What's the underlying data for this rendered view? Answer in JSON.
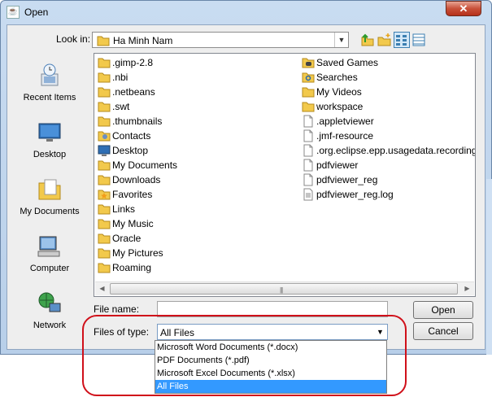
{
  "window": {
    "title": "Open",
    "icon": "java-cup-icon",
    "close_label": "✕"
  },
  "lookin": {
    "label": "Look in:",
    "value": "Ha Minh Nam"
  },
  "toolbar": [
    "up-folder-icon",
    "new-folder-icon",
    "list-view-icon",
    "details-view-icon"
  ],
  "places": [
    {
      "label": "Recent Items",
      "icon": "recent-items-icon"
    },
    {
      "label": "Desktop",
      "icon": "desktop-icon"
    },
    {
      "label": "My Documents",
      "icon": "my-documents-icon"
    },
    {
      "label": "Computer",
      "icon": "computer-icon"
    },
    {
      "label": "Network",
      "icon": "network-icon"
    }
  ],
  "files_col1": [
    {
      "name": ".gimp-2.8",
      "icon": "folder-icon"
    },
    {
      "name": ".nbi",
      "icon": "folder-icon"
    },
    {
      "name": ".netbeans",
      "icon": "folder-icon"
    },
    {
      "name": ".swt",
      "icon": "folder-icon"
    },
    {
      "name": ".thumbnails",
      "icon": "folder-icon"
    },
    {
      "name": "Contacts",
      "icon": "contacts-icon"
    },
    {
      "name": "Desktop",
      "icon": "desktop-icon"
    },
    {
      "name": "My Documents",
      "icon": "folder-icon"
    },
    {
      "name": "Downloads",
      "icon": "folder-icon"
    },
    {
      "name": "Favorites",
      "icon": "favorites-icon"
    },
    {
      "name": "Links",
      "icon": "folder-icon"
    },
    {
      "name": "My Music",
      "icon": "folder-icon"
    },
    {
      "name": "Oracle",
      "icon": "folder-icon"
    },
    {
      "name": "My Pictures",
      "icon": "folder-icon"
    },
    {
      "name": "Roaming",
      "icon": "folder-icon"
    }
  ],
  "files_col2": [
    {
      "name": "Saved Games",
      "icon": "saved-games-icon"
    },
    {
      "name": "Searches",
      "icon": "searches-icon"
    },
    {
      "name": "My Videos",
      "icon": "folder-icon"
    },
    {
      "name": "workspace",
      "icon": "folder-icon"
    },
    {
      "name": ".appletviewer",
      "icon": "file-icon"
    },
    {
      "name": ".jmf-resource",
      "icon": "file-icon"
    },
    {
      "name": ".org.eclipse.epp.usagedata.recording",
      "icon": "file-icon"
    },
    {
      "name": "pdfviewer",
      "icon": "file-icon"
    },
    {
      "name": "pdfviewer_reg",
      "icon": "file-icon"
    },
    {
      "name": "pdfviewer_reg.log",
      "icon": "text-file-icon"
    }
  ],
  "file_name": {
    "label": "File name:",
    "value": ""
  },
  "file_type": {
    "label": "Files of type:",
    "value": "All Files",
    "options": [
      "Microsoft Word Documents (*.docx)",
      "PDF Documents (*.pdf)",
      "Microsoft Excel Documents (*.xlsx)",
      "All Files"
    ],
    "selected_index": 3
  },
  "buttons": {
    "open": "Open",
    "cancel": "Cancel"
  },
  "colors": {
    "selection": "#3399ff",
    "annotation": "#d0101a"
  }
}
